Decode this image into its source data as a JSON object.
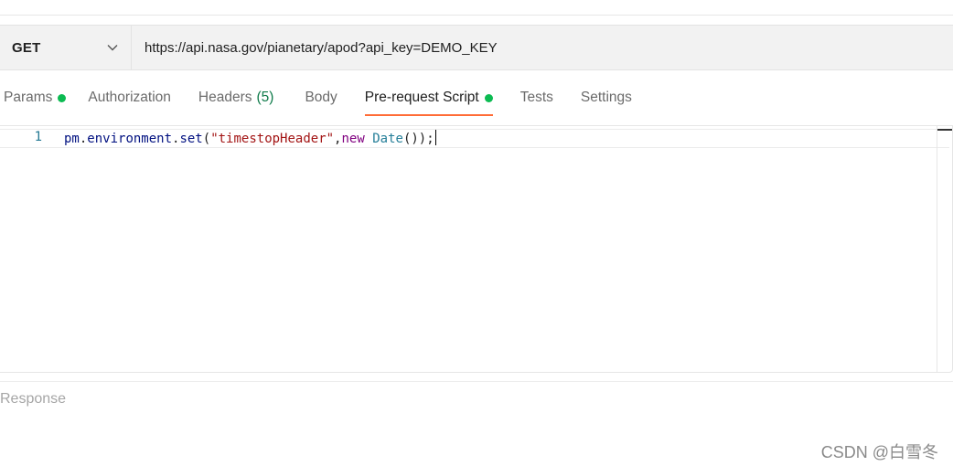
{
  "request": {
    "method": "GET",
    "url": "https://api.nasa.gov/pianetary/apod?api_key=DEMO_KEY"
  },
  "tabs": [
    {
      "label": "Params",
      "dot": true
    },
    {
      "label": "Authorization"
    },
    {
      "label": "Headers",
      "count": "(5)"
    },
    {
      "label": "Body"
    },
    {
      "label": "Pre-request Script",
      "dot": true,
      "active": true
    },
    {
      "label": "Tests"
    },
    {
      "label": "Settings"
    }
  ],
  "colors": {
    "accent": "#ff6c37",
    "dot": "#0cbb52",
    "count": "#0f7b4a"
  },
  "editor": {
    "line_number": "1",
    "code": {
      "t1": "pm",
      "t2": ".",
      "t3": "environment",
      "t4": ".",
      "t5": "set",
      "t6": "(",
      "t7": "\"timestopHeader\"",
      "t8": ",",
      "t9": "new",
      "t10": " ",
      "t11": "Date",
      "t12": "());"
    }
  },
  "response": {
    "label": "Response"
  },
  "watermark": "CSDN @白雪冬"
}
